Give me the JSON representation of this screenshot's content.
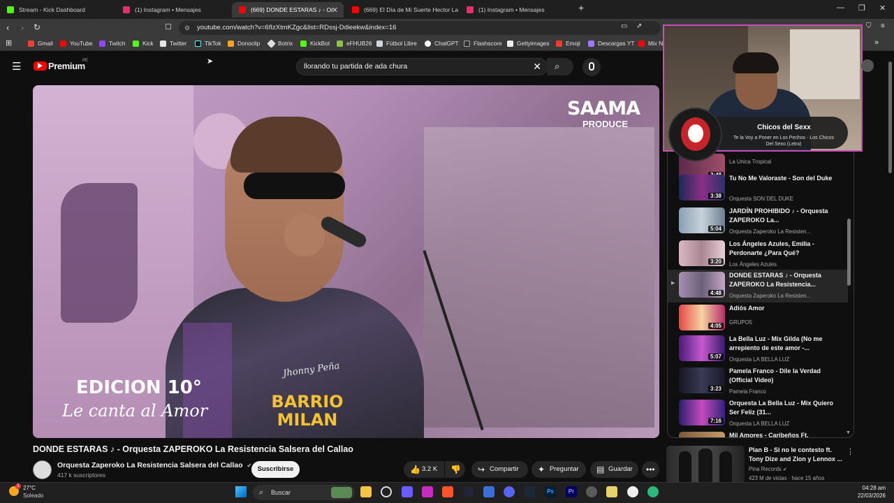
{
  "browser": {
    "tabs": [
      {
        "label": "Stream - Kick Dashboard",
        "color": "#53fc18"
      },
      {
        "label": "(1) Instagram • Mensajes",
        "color": "#e1306c"
      },
      {
        "label": "(669) DONDE ESTARAS ♪ - Or",
        "color": "#ff0000",
        "active": true
      },
      {
        "label": "(669) El Día de Mi Suerte Hector Lav",
        "color": "#ff0000"
      },
      {
        "label": "(1) Instagram • Mensajes",
        "color": "#e1306c"
      }
    ],
    "url": "youtube.com/watch?v=6fIzXtmKZgc&list=RDssj-Ddieekw&index=16",
    "bookmarks": [
      "Gmail",
      "YouTube",
      "Twitch",
      "Kick",
      "Twitter",
      "TikTok",
      "Donoclip",
      "Botrix",
      "KickBot",
      "eFHUB26",
      "Fútbol Libre",
      "ChatGPT",
      "Flashscore",
      "Gettyimages",
      "Emoji",
      "Descargas YT",
      "Mix N"
    ]
  },
  "youtube": {
    "logo": "Premium",
    "country": "PE",
    "search_value": "llorando tu partida de ada chura",
    "video": {
      "overlay_brand": "SAAMA",
      "overlay_sub": "PRODUCE",
      "overlay_edition": "EDICION 10°",
      "overlay_tagline": "Le canta al Amor",
      "overlay_shirt": "BARRIO MILAN",
      "overlay_shirt_name": "Jhonny Peña"
    },
    "title": "DONDE ESTARAS ♪ - Orquesta ZAPEROKO La Resistencia Salsera del Callao",
    "channel": "Orquesta Zaperoko La Resistencia Salsera del Callao",
    "subscribers": "417 k suscriptores",
    "subscribe_label": "Suscribirse",
    "likes": "3.2 K",
    "share_label": "Compartir",
    "ask_label": "Preguntar",
    "save_label": "Guardar"
  },
  "playlist": [
    {
      "title": "",
      "channel": "La Unica Tropical",
      "duration": "3:48"
    },
    {
      "title": "Tu No Me Valoraste - Son del Duke",
      "channel": "Orquesta SON DEL DUKE",
      "duration": "3:38"
    },
    {
      "title": "JARDÍN PROHIBIDO ♪ - Orquesta ZAPEROKO La...",
      "channel": "Orquesta Zaperoko La Resisten...",
      "duration": "5:04"
    },
    {
      "title": "Los Ángeles Azules, Emilia - Perdonarte ¿Para Qué?",
      "channel": "Los Ángeles Azules",
      "duration": "3:20"
    },
    {
      "title": "DONDE ESTARAS ♪ - Orquesta ZAPEROKO La Resistencia...",
      "channel": "Orquesta Zaperoko La Resisten...",
      "duration": "4:48",
      "current": true
    },
    {
      "title": "Adiós Amor",
      "channel": "GRUPO5",
      "duration": "4:05"
    },
    {
      "title": "La Bella Luz - Mix Gilda (No me arrepiento de este amor -...",
      "channel": "Orquesta LA BELLA LUZ",
      "duration": "5:07"
    },
    {
      "title": "Pamela Franco - Dile la Verdad (Official Video)",
      "channel": "Pamela Franco",
      "duration": "3:23"
    },
    {
      "title": "Orquesta La Bella Luz - Mix Quiero Ser Feliz (31...",
      "channel": "Orquesta LA BELLA LUZ",
      "duration": "7:16"
    },
    {
      "title": "Mil Amores - Caribeños Ft.",
      "channel": "",
      "duration": ""
    }
  ],
  "now_playing": {
    "artist": "Chicos del Sexx",
    "song": "Te la Voy a Poner en Los Pechos - Los Chicos Del Sexo (Letra)"
  },
  "recommended": {
    "title": "Plan B - Si no le contesto ft. Tony Dize and Zion y Lennox ...",
    "channel": "Pina Records",
    "meta": "423 M de vistas · hace 15 años"
  },
  "taskbar": {
    "weather_temp": "27°C",
    "weather_desc": "Soleado",
    "search_label": "Buscar",
    "time": "04:28 am",
    "date": "22/03/2026"
  }
}
